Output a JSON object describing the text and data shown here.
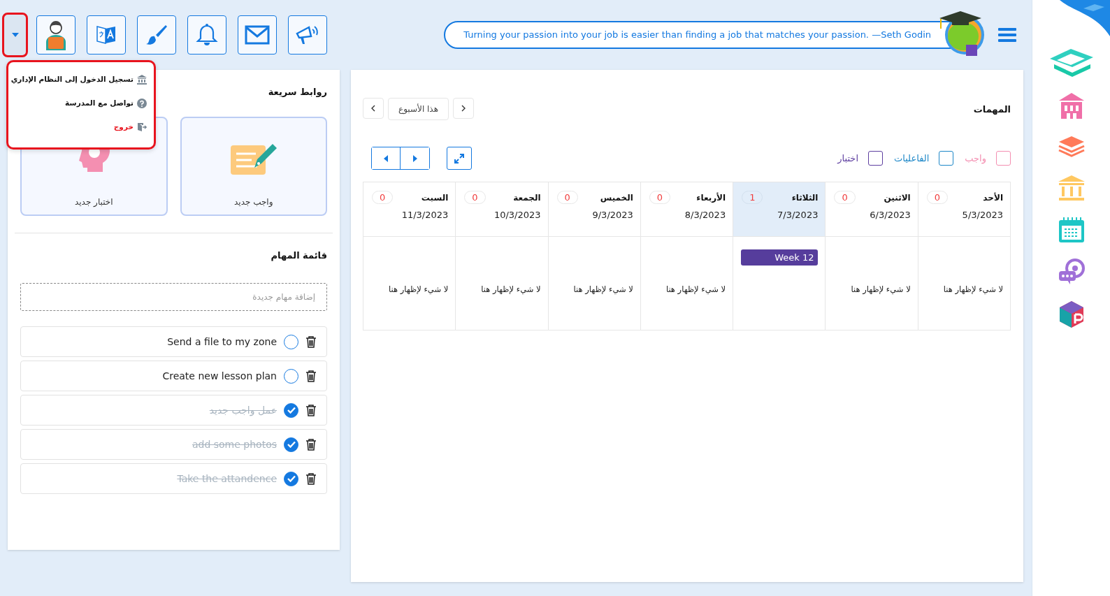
{
  "toolbar": {
    "menu_open": true
  },
  "menu": {
    "items": [
      {
        "label": "تسجيل الدخول إلى النظام الإداري",
        "kind": "admin"
      },
      {
        "label": "تواصل مع المدرسة",
        "kind": "help"
      },
      {
        "label": "خروج",
        "kind": "logout"
      }
    ]
  },
  "quote": "Turning your passion into your job is easier than finding a job that matches your passion. —Seth Godin",
  "quick_links": {
    "title": "روابط سريعة",
    "cards": [
      {
        "label": "واجب جديد",
        "kind": "homework"
      },
      {
        "label": "اختبار جديد",
        "kind": "quiz"
      }
    ]
  },
  "todo": {
    "title": "قائمة المهام",
    "placeholder": "إضافة مهام جديدة",
    "items": [
      {
        "text": "Send a file to my zone",
        "done": false
      },
      {
        "text": "Create new lesson plan",
        "done": false
      },
      {
        "text": "عمل واجب جديد",
        "done": true
      },
      {
        "text": "add some photos",
        "done": true
      },
      {
        "text": "Take the attandence",
        "done": true
      }
    ]
  },
  "tasks": {
    "title": "المهمات",
    "week_label": "هذا الأسبوع",
    "filters": [
      {
        "label": "واجب",
        "color": "#f48fb1",
        "checked": false
      },
      {
        "label": "الفاعليات",
        "color": "#1e88c8",
        "checked": false
      },
      {
        "label": "اختبار",
        "color": "#5e3fa0",
        "checked": false
      }
    ],
    "days": [
      {
        "name": "الأحد",
        "date": "5/3/2023",
        "count": "0",
        "selected": false,
        "empty_text": "لا شيء لإظهار هنا"
      },
      {
        "name": "الاثنين",
        "date": "6/3/2023",
        "count": "0",
        "selected": false,
        "empty_text": "لا شيء لإظهار هنا"
      },
      {
        "name": "الثلاثاء",
        "date": "7/3/2023",
        "count": "1",
        "selected": true,
        "events": [
          "Week 12"
        ]
      },
      {
        "name": "الأربعاء",
        "date": "8/3/2023",
        "count": "0",
        "selected": false,
        "empty_text": "لا شيء لإظهار هنا"
      },
      {
        "name": "الخميس",
        "date": "9/3/2023",
        "count": "0",
        "selected": false,
        "empty_text": "لا شيء لإظهار هنا"
      },
      {
        "name": "الجمعة",
        "date": "10/3/2023",
        "count": "0",
        "selected": false,
        "empty_text": "لا شيء لإظهار هنا"
      },
      {
        "name": "السبت",
        "date": "11/3/2023",
        "count": "0",
        "selected": false,
        "empty_text": "لا شيء لإظهار هنا"
      }
    ]
  }
}
